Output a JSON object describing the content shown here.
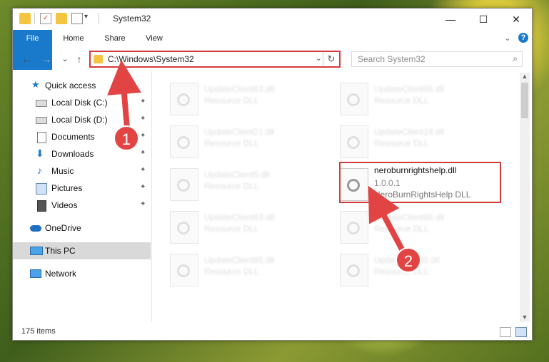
{
  "window": {
    "title": "System32",
    "controls": [
      "—",
      "☐",
      "✕"
    ]
  },
  "ribbon": {
    "tabs": [
      "File",
      "Home",
      "Share",
      "View"
    ],
    "expand_icon": "chevron-down-icon",
    "help_icon": "?"
  },
  "address": {
    "path": "C:\\Windows\\System32",
    "dropdown": "⌄",
    "refresh": "↻"
  },
  "search": {
    "placeholder": "Search System32",
    "icon": "⌕"
  },
  "nav_buttons": {
    "back": "←",
    "forward": "→",
    "recent": "⌄",
    "up": "↑"
  },
  "sidebar": {
    "items": [
      {
        "label": "Quick access",
        "icon": "star-icon"
      },
      {
        "label": "Local Disk (C:)",
        "icon": "drive-icon",
        "pinned": true
      },
      {
        "label": "Local Disk (D:)",
        "icon": "drive-icon",
        "pinned": true
      },
      {
        "label": "Documents",
        "icon": "documents-icon",
        "pinned": true
      },
      {
        "label": "Downloads",
        "icon": "download-arrow-icon",
        "pinned": true
      },
      {
        "label": "Music",
        "icon": "music-note-icon",
        "pinned": true
      },
      {
        "label": "Pictures",
        "icon": "pictures-icon",
        "pinned": true
      },
      {
        "label": "Videos",
        "icon": "film-icon",
        "pinned": true
      },
      {
        "label": "OneDrive",
        "icon": "cloud-icon"
      },
      {
        "label": "This PC",
        "icon": "computer-icon",
        "selected": true
      },
      {
        "label": "Network",
        "icon": "network-icon"
      }
    ],
    "pin_glyph": "📌"
  },
  "files": [
    {
      "name": "UpdateClient63.dll",
      "desc": "Resource DLL"
    },
    {
      "name": "UpdateClient65.dll",
      "desc": "Resource DLL"
    },
    {
      "name": "UpdateClient21.dll",
      "desc": "Resource DLL"
    },
    {
      "name": "UpdateClient19.dll",
      "desc": "Resource DLL"
    },
    {
      "name": "UpdateClient5.dll",
      "desc": "Resource DLL"
    },
    {
      "name": "neroburnrightshelp.dll",
      "version": "1.0.0.1",
      "desc": "NeroBurnRightsHelp DLL"
    },
    {
      "name": "UpdateClient63.dll",
      "desc": "Resource DLL"
    },
    {
      "name": "UpdateClient65.dll",
      "desc": "Resource DLL"
    },
    {
      "name": "UpdateClient65.dll",
      "desc": "Resource DLL"
    },
    {
      "name": "UpdateClient5.dll",
      "desc": "Resource DLL"
    }
  ],
  "status": {
    "items_count": "175 items"
  },
  "annotations": {
    "step1": "1",
    "step2": "2",
    "color": "#e24444"
  }
}
